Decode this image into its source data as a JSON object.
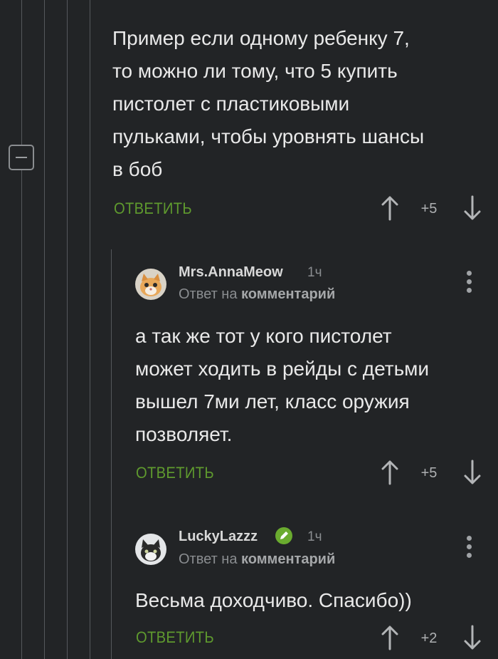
{
  "thread": {
    "parent_comment": {
      "text": "Пример если одному ребенку 7,\nто можно ли тому, что 5 купить\nпистолет с пластиковыми\nпульками, чтобы уровнять шансы\nв боб",
      "reply_label": "ОТВЕТИТЬ",
      "rating": "+5"
    },
    "comments": [
      {
        "author": "Mrs.AnnaMeow",
        "time": "1ч",
        "reply_prefix": "Ответ на",
        "reply_target": "комментарий",
        "text": "а так же тот у кого пистолет\nможет ходить в рейды с детьми\nвышел 7ми лет, класс оружия\nпозволяет.",
        "reply_label": "ОТВЕТИТЬ",
        "rating": "+5",
        "avatar_icon": "cat-avatar-icon"
      },
      {
        "author": "LuckyLazzz",
        "time": "1ч",
        "reply_prefix": "Ответ на",
        "reply_target": "комментарий",
        "text": "Весьма доходчиво. Спасибо))",
        "reply_label": "ОТВЕТИТЬ",
        "rating": "+2",
        "avatar_icon": "cat-avatar-icon",
        "verified_icon": "pencil-check-icon"
      }
    ]
  },
  "colors": {
    "background": "#222426",
    "accent_green": "#5f9a2e",
    "text": "#e9e9e9",
    "muted": "#8a8d90"
  }
}
